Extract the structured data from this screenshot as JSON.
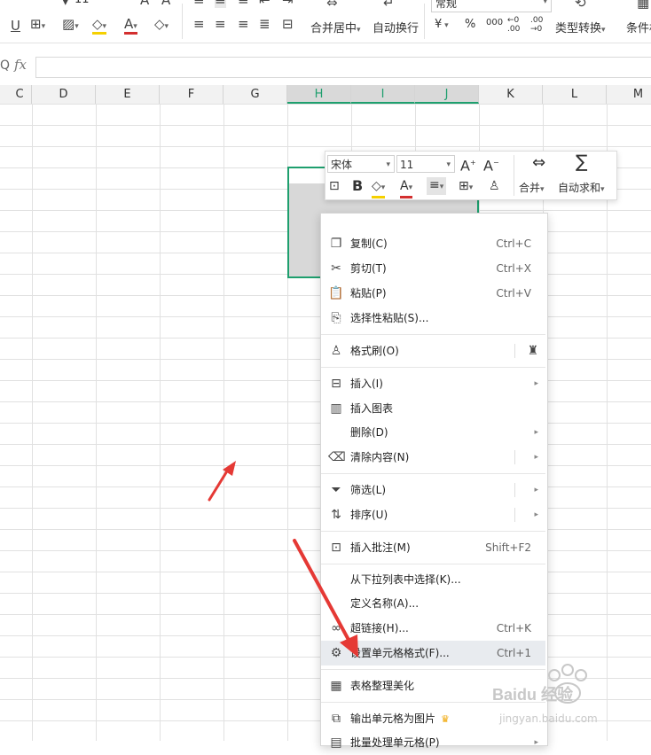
{
  "ribbon": {
    "font_size": "11",
    "number_format": "常规",
    "merge_center": "合并居中",
    "wrap_text": "自动换行",
    "currency": "¥",
    "percent": "%",
    "thousands": "000",
    "inc_decimal": "←0 .00",
    "dec_decimal": ".00 →0",
    "type_convert": "类型转换",
    "cond_format": "条件格"
  },
  "formula_bar": {
    "fx_label": "fx",
    "value": ""
  },
  "columns": [
    "C",
    "D",
    "E",
    "F",
    "G",
    "H",
    "I",
    "J",
    "K",
    "L",
    "M"
  ],
  "selected_columns": [
    "H",
    "I",
    "J"
  ],
  "mini_toolbar": {
    "font_name": "宋体",
    "font_size": "11",
    "bold": "B",
    "merge": "合并",
    "autosum": "自动求和"
  },
  "context_menu": {
    "items": [
      {
        "label": "复制(C)",
        "shortcut": "Ctrl+C"
      },
      {
        "label": "剪切(T)",
        "shortcut": "Ctrl+X"
      },
      {
        "label": "粘贴(P)",
        "shortcut": "Ctrl+V"
      },
      {
        "label": "选择性粘贴(S)...",
        "shortcut": ""
      },
      {
        "label": "格式刷(O)",
        "shortcut": ""
      },
      {
        "label": "插入(I)",
        "shortcut": ""
      },
      {
        "label": "插入图表",
        "shortcut": ""
      },
      {
        "label": "删除(D)",
        "shortcut": ""
      },
      {
        "label": "清除内容(N)",
        "shortcut": ""
      },
      {
        "label": "筛选(L)",
        "shortcut": ""
      },
      {
        "label": "排序(U)",
        "shortcut": ""
      },
      {
        "label": "插入批注(M)",
        "shortcut": "Shift+F2"
      },
      {
        "label": "从下拉列表中选择(K)...",
        "shortcut": ""
      },
      {
        "label": "定义名称(A)...",
        "shortcut": ""
      },
      {
        "label": "超链接(H)...",
        "shortcut": "Ctrl+K"
      },
      {
        "label": "设置单元格格式(F)...",
        "shortcut": "Ctrl+1"
      },
      {
        "label": "表格整理美化",
        "shortcut": ""
      },
      {
        "label": "输出单元格为图片",
        "shortcut": ""
      },
      {
        "label": "批量处理单元格(P)",
        "shortcut": ""
      }
    ]
  },
  "watermark": {
    "brand": "Baidu 经验",
    "url": "jingyan.baidu.com"
  },
  "colors": {
    "accent": "#1e9f6e",
    "arrow": "#e53935",
    "highlight": "#e8ebef"
  }
}
